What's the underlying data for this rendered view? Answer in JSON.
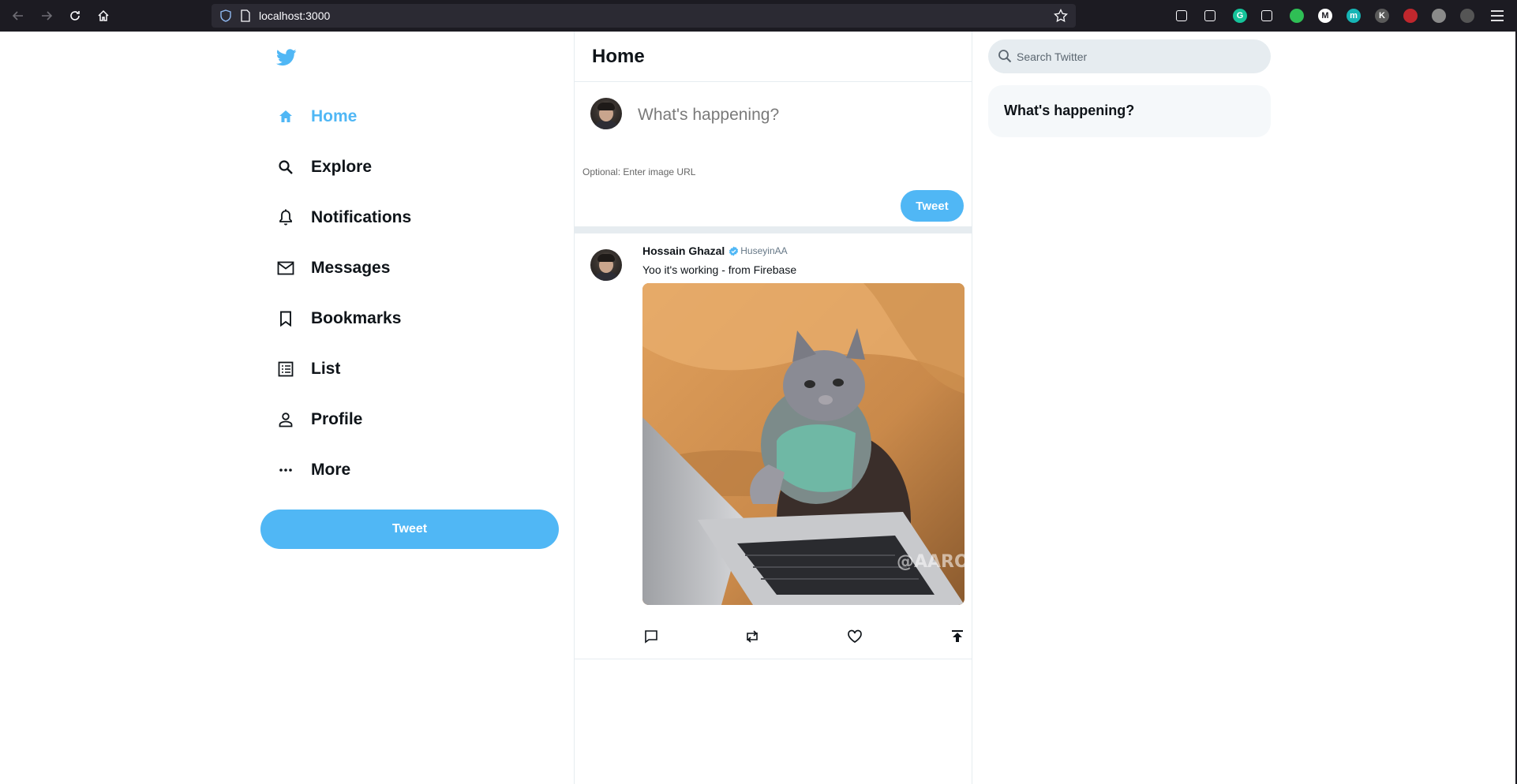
{
  "browser": {
    "url": "localhost:3000",
    "extensions": [
      {
        "name": "pocket-icon",
        "letter": ""
      },
      {
        "name": "library-icon",
        "letter": ""
      },
      {
        "name": "grammarly-icon",
        "letter": "G",
        "color": "#15c39a"
      },
      {
        "name": "globe-icon",
        "letter": ""
      },
      {
        "name": "vpn-shield-icon",
        "letter": "",
        "color": "#2fbf55"
      },
      {
        "name": "medium-icon",
        "letter": "M",
        "color": "#ffffff"
      },
      {
        "name": "m-extension-icon",
        "letter": "m",
        "color": "#16b5b5"
      },
      {
        "name": "k-extension-icon",
        "letter": "K",
        "color": "#5a5a5a"
      },
      {
        "name": "red-extension-icon",
        "letter": "",
        "color": "#c0272d"
      },
      {
        "name": "circle-extension-icon",
        "letter": "",
        "color": "#8a8a8a"
      },
      {
        "name": "grid-extension-icon",
        "letter": "",
        "color": "#555555"
      }
    ]
  },
  "sidebar": {
    "items": [
      {
        "label": "Home",
        "icon": "home-icon",
        "active": true
      },
      {
        "label": "Explore",
        "icon": "search-icon",
        "active": false
      },
      {
        "label": "Notifications",
        "icon": "bell-icon",
        "active": false
      },
      {
        "label": "Messages",
        "icon": "mail-icon",
        "active": false
      },
      {
        "label": "Bookmarks",
        "icon": "bookmark-icon",
        "active": false
      },
      {
        "label": "List",
        "icon": "list-icon",
        "active": false
      },
      {
        "label": "Profile",
        "icon": "person-icon",
        "active": false
      },
      {
        "label": "More",
        "icon": "more-icon",
        "active": false
      }
    ],
    "tweet_button": "Tweet"
  },
  "feed": {
    "title": "Home",
    "tweetbox": {
      "placeholder": "What's happening?",
      "image_placeholder": "Optional: Enter image URL",
      "button": "Tweet"
    },
    "post": {
      "display_name": "Hossain Ghazal",
      "username": "HuseyinAA",
      "text": "Yoo it's working - from Firebase",
      "image_watermark": "@AARON",
      "actions": [
        "reply-icon",
        "retweet-icon",
        "like-icon",
        "share-icon"
      ]
    }
  },
  "widgets": {
    "search_placeholder": "Search Twitter",
    "happening_title": "What's happening?"
  },
  "colors": {
    "accent": "#50b7f5",
    "browser_bg": "#1c1b22",
    "border": "#e6ecf0"
  }
}
